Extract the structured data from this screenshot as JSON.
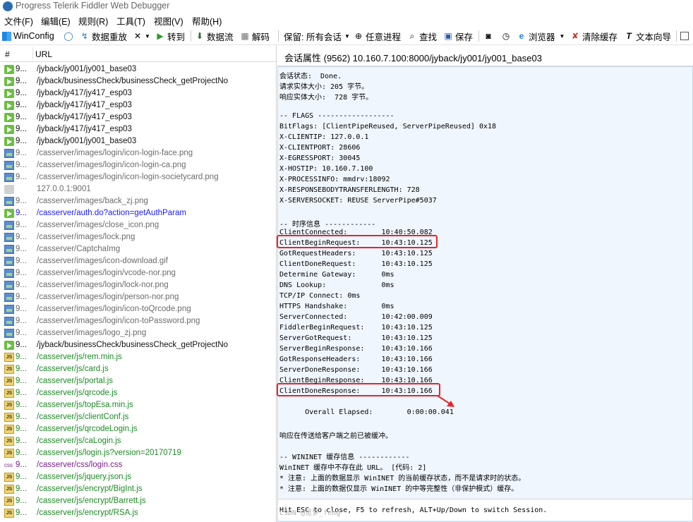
{
  "window": {
    "title": "Progress Telerik Fiddler Web Debugger"
  },
  "menu": [
    "文件(F)",
    "编辑(E)",
    "规则(R)",
    "工具(T)",
    "视图(V)",
    "帮助(H)"
  ],
  "toolbar": {
    "winconfig": "WinConfig",
    "replay": "数据重放",
    "go": "转到",
    "stream": "数据流",
    "decode": "解码",
    "keep": "保留: 所有会话",
    "any_process": "任意进程",
    "find": "查找",
    "save": "保存",
    "browser": "浏览器",
    "clear_cache": "清除缓存",
    "text_wizard": "文本向导"
  },
  "sessions": {
    "col_num": "#",
    "col_url": "URL",
    "rows": [
      {
        "icon": "arrow",
        "num": "9...",
        "url": "/jyback/jy001/jy001_base03",
        "color": "black",
        "selected": true
      },
      {
        "icon": "arrow",
        "num": "9...",
        "url": "/jyback/businessCheck/businessCheck_getProjectNo",
        "color": "black"
      },
      {
        "icon": "arrow",
        "num": "9...",
        "url": "/jyback/jy417/jy417_esp03",
        "color": "black"
      },
      {
        "icon": "arrow",
        "num": "9...",
        "url": "/jyback/jy417/jy417_esp03",
        "color": "black"
      },
      {
        "icon": "arrow",
        "num": "9...",
        "url": "/jyback/jy417/jy417_esp03",
        "color": "black"
      },
      {
        "icon": "arrow",
        "num": "9...",
        "url": "/jyback/jy417/jy417_esp03",
        "color": "black"
      },
      {
        "icon": "arrow",
        "num": "9...",
        "url": "/jyback/jy001/jy001_base03",
        "color": "black"
      },
      {
        "icon": "image",
        "num": "9...",
        "url": "/casserver/images/login/icon-login-face.png",
        "color": "gray"
      },
      {
        "icon": "image",
        "num": "9...",
        "url": "/casserver/images/login/icon-login-ca.png",
        "color": "gray"
      },
      {
        "icon": "image",
        "num": "9...",
        "url": "/casserver/images/login/icon-login-societycard.png",
        "color": "gray"
      },
      {
        "icon": "lock",
        "num": "",
        "url": "127.0.0.1:9001",
        "color": "gray"
      },
      {
        "icon": "image",
        "num": "9...",
        "url": "/casserver/images/back_zj.png",
        "color": "gray"
      },
      {
        "icon": "arrow",
        "num": "9...",
        "url": "/casserver/auth.do?action=getAuthParam",
        "color": "blue"
      },
      {
        "icon": "image",
        "num": "9...",
        "url": "/casserver/images/close_icon.png",
        "color": "gray"
      },
      {
        "icon": "image",
        "num": "9...",
        "url": "/casserver/images/lock.png",
        "color": "gray"
      },
      {
        "icon": "image",
        "num": "9...",
        "url": "/casserver/CaptchaImg",
        "color": "gray"
      },
      {
        "icon": "image",
        "num": "9...",
        "url": "/casserver/images/icon-download.gif",
        "color": "gray"
      },
      {
        "icon": "image",
        "num": "9...",
        "url": "/casserver/images/login/vcode-nor.png",
        "color": "gray"
      },
      {
        "icon": "image",
        "num": "9...",
        "url": "/casserver/images/login/lock-nor.png",
        "color": "gray"
      },
      {
        "icon": "image",
        "num": "9...",
        "url": "/casserver/images/login/person-nor.png",
        "color": "gray"
      },
      {
        "icon": "image",
        "num": "9...",
        "url": "/casserver/images/login/icon-toQrcode.png",
        "color": "gray"
      },
      {
        "icon": "image",
        "num": "9...",
        "url": "/casserver/images/login/icon-toPassword.png",
        "color": "gray"
      },
      {
        "icon": "image",
        "num": "9...",
        "url": "/casserver/images/logo_zj.png",
        "color": "gray"
      },
      {
        "icon": "arrow",
        "num": "9...",
        "url": "/jyback/businessCheck/businessCheck_getProjectNo",
        "color": "black"
      },
      {
        "icon": "js",
        "num": "9...",
        "url": "/casserver/js/rem.min.js",
        "color": "green"
      },
      {
        "icon": "js",
        "num": "9...",
        "url": "/casserver/js/card.js",
        "color": "green"
      },
      {
        "icon": "js",
        "num": "9...",
        "url": "/casserver/js/portal.js",
        "color": "green"
      },
      {
        "icon": "js",
        "num": "9...",
        "url": "/casserver/js/qrcode.js",
        "color": "green"
      },
      {
        "icon": "js",
        "num": "9...",
        "url": "/casserver/js/topEsa.min.js",
        "color": "green"
      },
      {
        "icon": "js",
        "num": "9...",
        "url": "/casserver/js/clientConf.js",
        "color": "green"
      },
      {
        "icon": "js",
        "num": "9...",
        "url": "/casserver/js/qrcodeLogin.js",
        "color": "green"
      },
      {
        "icon": "js",
        "num": "9...",
        "url": "/casserver/js/caLogin.js",
        "color": "green"
      },
      {
        "icon": "js",
        "num": "9...",
        "url": "/casserver/js/login.js?version=20170719",
        "color": "green"
      },
      {
        "icon": "css",
        "num": "9...",
        "url": "/casserver/css/login.css",
        "color": "purple"
      },
      {
        "icon": "js",
        "num": "9...",
        "url": "/casserver/js/jquery.json.js",
        "color": "green"
      },
      {
        "icon": "js",
        "num": "9...",
        "url": "/casserver/js/encrypt/BigInt.js",
        "color": "green"
      },
      {
        "icon": "js",
        "num": "9...",
        "url": "/casserver/js/encrypt/Barrett.js",
        "color": "green"
      },
      {
        "icon": "js",
        "num": "9...",
        "url": "/casserver/js/encrypt/RSA.js",
        "color": "green"
      }
    ]
  },
  "properties": {
    "title": "会话属性 (9562) 10.160.7.100:8000/jyback/jy001/jy001_base03",
    "lines": [
      "会话状态:  Done.",
      "请求实体大小: 205 字节。",
      "响应实体大小:  728 字节。",
      "",
      "-- FLAGS ------------------",
      "BitFlags: [ClientPipeReused, ServerPipeReused] 0x18",
      "X-CLIENTIP: 127.0.0.1",
      "X-CLIENTPORT: 28606",
      "X-EGRESSPORT: 30045",
      "X-HOSTIP: 10.160.7.100",
      "X-PROCESSINFO: mmdrv:18092",
      "X-RESPONSEBODYTRANSFERLENGTH: 728",
      "X-SERVERSOCKET: REUSE ServerPipe#5037",
      "",
      "-- 时序信息 ------------",
      "ClientConnected:        10:40:50.082",
      "ClientBeginRequest:     10:43:10.125",
      "GotRequestHeaders:      10:43:10.125",
      "ClientDoneRequest:      10:43:10.125",
      "Determine Gateway:      0ms",
      "DNS Lookup:             0ms",
      "TCP/IP Connect: 0ms",
      "HTTPS Handshake:        0ms",
      "ServerConnected:        10:42:00.009",
      "FiddlerBeginRequest:    10:43:10.125",
      "ServerGotRequest:       10:43:10.125",
      "ServerBeginResponse:    10:43:10.166",
      "GotResponseHeaders:     10:43:10.166",
      "ServerDoneResponse:     10:43:10.166",
      "ClientBeginResponse:    10:43:10.166",
      "ClientDoneResponse:     10:43:10.166",
      "",
      "      Overall Elapsed:        0:00:00.041",
      "",
      "响应在传送给客户端之前已被缓冲。",
      "",
      "-- WININET 缓存信息 ------------",
      "WinINET 缓存中不存在此 URL。 [代码: 2]",
      "* 注意: 上面的数据显示 WinINET 的当前缓存状态，而不是请求时的状态。",
      "* 注意: 上面的数据仅显示 WinINET 的中等完整性（非保护模式）缓存。"
    ],
    "footer": "Hit ESC to close, F5 to refresh, ALT+Up/Down to switch Session.",
    "watermark": "CSDN @觅梦_feng"
  }
}
